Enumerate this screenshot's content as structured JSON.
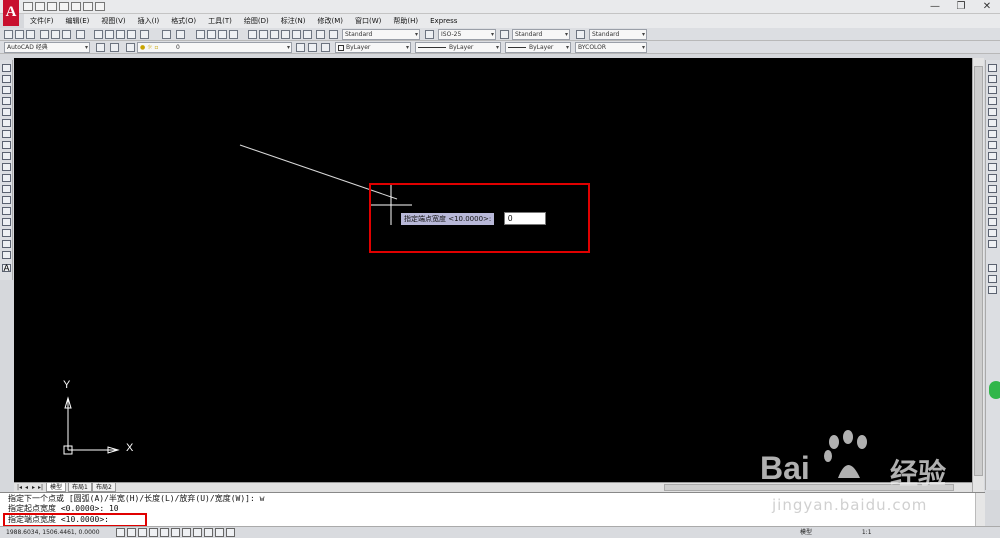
{
  "app": {
    "logo": "A",
    "quick_access_icons": [
      "new-icon",
      "open-icon",
      "save-icon",
      "saveas-icon",
      "print-icon",
      "undo-icon",
      "redo-icon"
    ],
    "window_controls": {
      "minimize": "—",
      "restore": "❐",
      "close": "✕"
    }
  },
  "menubar": {
    "items": [
      "文件(F)",
      "编辑(E)",
      "视图(V)",
      "插入(I)",
      "格式(O)",
      "工具(T)",
      "绘图(D)",
      "标注(N)",
      "修改(M)",
      "窗口(W)",
      "帮助(H)",
      "Express"
    ]
  },
  "toolbar": {
    "text_style": "Standard",
    "dim_style": "ISO-25",
    "table_style": "Standard",
    "mleader_style": "Standard",
    "workspace": "AutoCAD 经典",
    "layer": "0",
    "color": "ByLayer",
    "linetype": "ByLayer",
    "lineweight": "ByLayer",
    "plotstyle": "BYCOLOR"
  },
  "dynamic_input": {
    "prompt": "指定端点宽度 <10.0000>:",
    "value": "0"
  },
  "ucs": {
    "x_label": "X",
    "y_label": "Y"
  },
  "tabs": {
    "model": "模型",
    "layout1": "布局1",
    "layout2": "布局2"
  },
  "command_line": {
    "history": [
      "指定下一个点或 [圆弧(A)/半宽(H)/长度(L)/放弃(U)/宽度(W)]: w",
      "指定起点宽度 <0.0000>: 10"
    ],
    "current": "指定端点宽度 <10.0000>:"
  },
  "statusbar": {
    "coords": "1988.6034, 1506.4461, 0.0000",
    "model_label": "模型",
    "annotation_scale": "1:1"
  },
  "watermark": {
    "brand": "Bai",
    "brand_suffix": "经验",
    "url": "jingyan.baidu.com"
  },
  "colors": {
    "canvas": "#000000",
    "highlight": "#e00000",
    "dyn_label_bg": "#b8b8d8"
  }
}
